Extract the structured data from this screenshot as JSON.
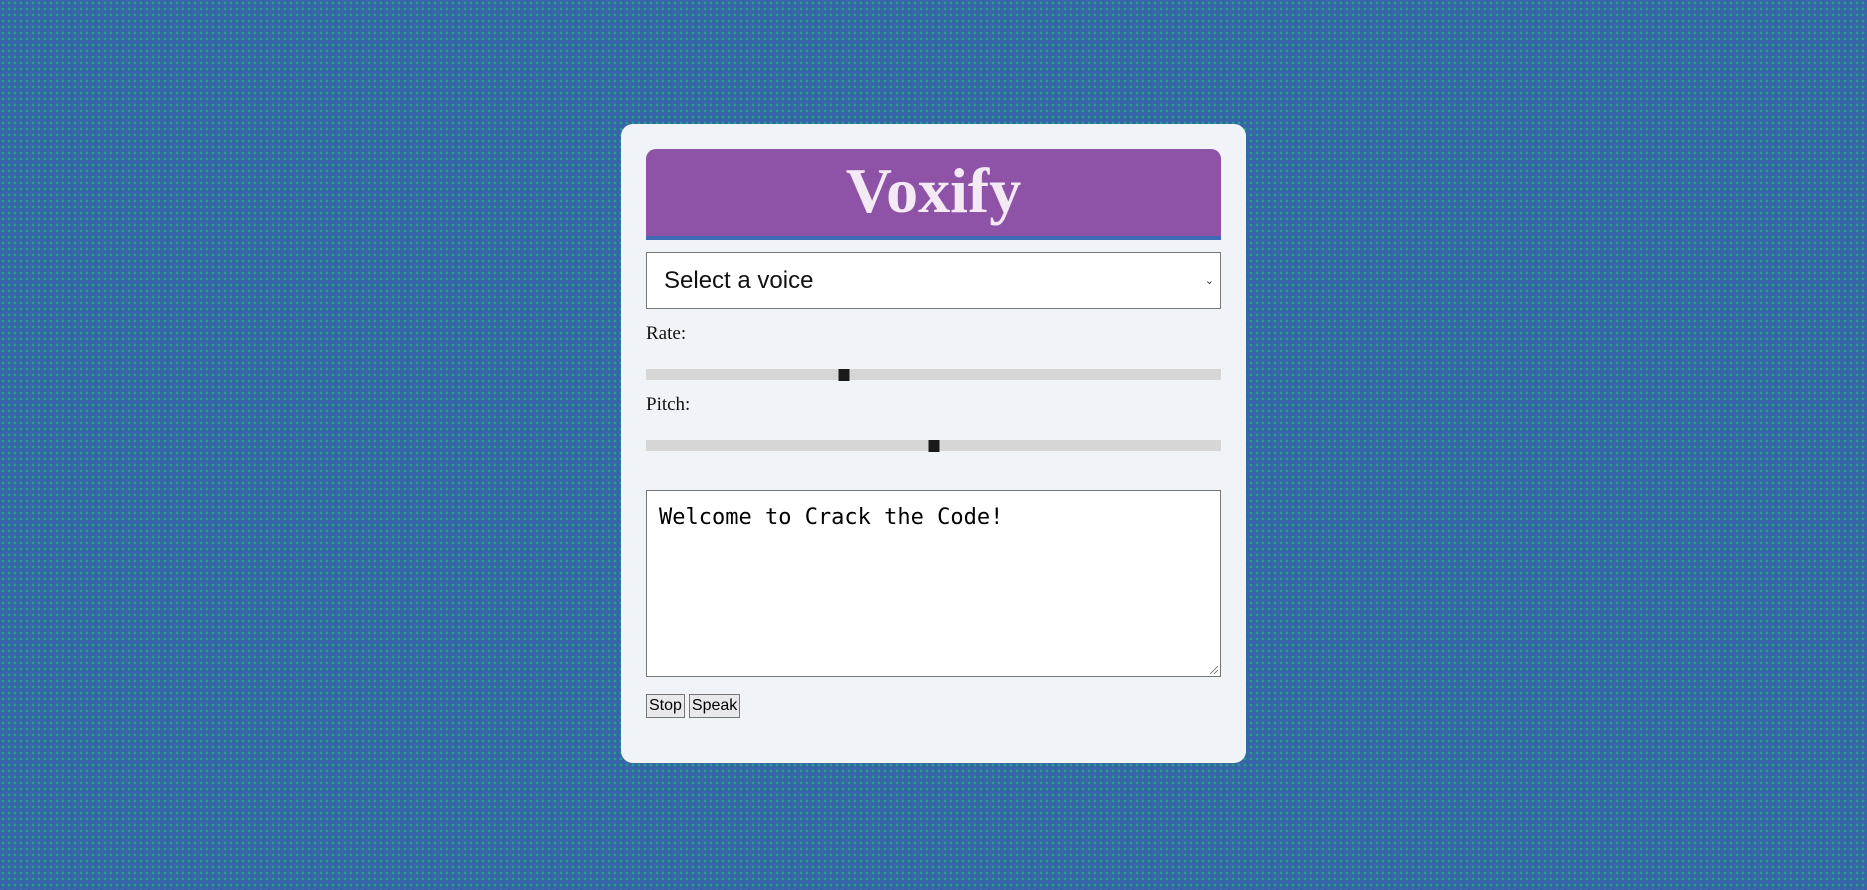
{
  "app": {
    "title": "Voxify"
  },
  "voice_select": {
    "value": "Select a voice"
  },
  "rate": {
    "label": "Rate:",
    "level": 0.345
  },
  "pitch": {
    "label": "Pitch:",
    "level": 0.5
  },
  "text_input": {
    "value": "Welcome to Crack the Code!"
  },
  "buttons": {
    "stop_label": "Stop",
    "speak_label": "Speak"
  },
  "colors": {
    "header_bg": "#8e52a6",
    "header_accent": "#3f6ab6",
    "page_bg": "#3465a4",
    "card_bg": "#f0f3f7"
  }
}
